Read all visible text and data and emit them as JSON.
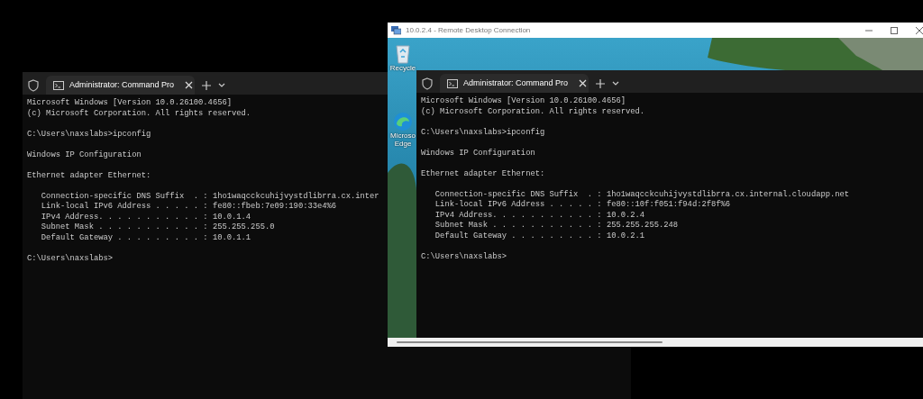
{
  "left_terminal": {
    "tab_title": "Administrator: Command Pro",
    "blocks": [
      {
        "kind": "output",
        "lines": [
          "Microsoft Windows [Version 10.0.26100.4656]",
          "(c) Microsoft Corporation. All rights reserved."
        ]
      },
      {
        "kind": "output",
        "lines": [
          "C:\\Users\\naxslabs>ipconfig"
        ]
      },
      {
        "kind": "output",
        "lines": [
          "Windows IP Configuration"
        ]
      },
      {
        "kind": "section",
        "lines": [
          "Ethernet adapter Ethernet:"
        ]
      },
      {
        "kind": "output",
        "lines": [
          "   Connection-specific DNS Suffix  . : 1ho1waqcckcuhijvystdlibrra.cx.inter",
          "   Link-local IPv6 Address . . . . . : fe80::fbeb:7e09:190:33e4%6",
          "   IPv4 Address. . . . . . . . . . . : 10.0.1.4",
          "   Subnet Mask . . . . . . . . . . . : 255.255.255.0",
          "   Default Gateway . . . . . . . . . : 10.0.1.1"
        ]
      },
      {
        "kind": "output",
        "lines": [
          "C:\\Users\\naxslabs>"
        ]
      }
    ]
  },
  "remote_desktop": {
    "title": "10.0.2.4 - Remote Desktop Connection",
    "desktop_icons": [
      {
        "kind": "recycle",
        "label": [
          "Recycle"
        ]
      },
      {
        "kind": "edge",
        "label": [
          "Microso",
          "Edge"
        ]
      }
    ],
    "terminal": {
      "tab_title": "Administrator: Command Pro",
      "blocks": [
        {
          "kind": "output",
          "lines": [
            "Microsoft Windows [Version 10.0.26100.4656]",
            "(c) Microsoft Corporation. All rights reserved."
          ]
        },
        {
          "kind": "output",
          "lines": [
            "C:\\Users\\naxslabs>ipconfig"
          ]
        },
        {
          "kind": "output",
          "lines": [
            "Windows IP Configuration"
          ]
        },
        {
          "kind": "section",
          "lines": [
            "Ethernet adapter Ethernet:"
          ]
        },
        {
          "kind": "output",
          "lines": [
            "   Connection-specific DNS Suffix  . : 1ho1waqcckcuhijvystdlibrra.cx.internal.cloudapp.net",
            "   Link-local IPv6 Address . . . . . : fe80::10f:f051:f94d:2f8f%6",
            "   IPv4 Address. . . . . . . . . . . : 10.0.2.4",
            "   Subnet Mask . . . . . . . . . . . : 255.255.255.248",
            "   Default Gateway . . . . . . . . . : 10.0.2.1"
          ]
        },
        {
          "kind": "output",
          "lines": [
            "C:\\Users\\naxslabs>"
          ]
        }
      ]
    }
  }
}
